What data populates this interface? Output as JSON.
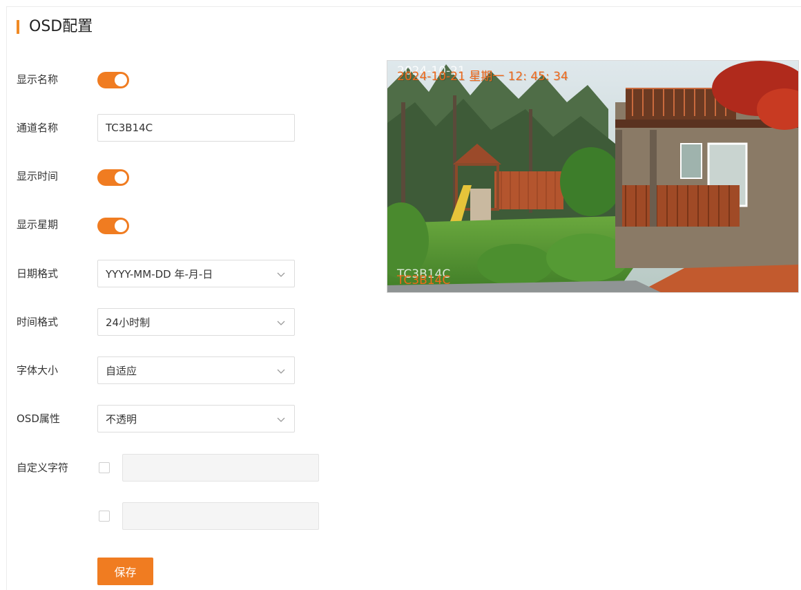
{
  "page": {
    "title": "OSD配置",
    "accent_color": "#f07c21"
  },
  "form": {
    "show_name": {
      "label": "显示名称",
      "on": true
    },
    "channel_name": {
      "label": "通道名称",
      "value": "TC3B14C"
    },
    "show_time": {
      "label": "显示时间",
      "on": true
    },
    "show_weekday": {
      "label": "显示星期",
      "on": true
    },
    "date_format": {
      "label": "日期格式",
      "value": "YYYY-MM-DD 年-月-日",
      "icon": "chevron-down-icon"
    },
    "time_format": {
      "label": "时间格式",
      "value": "24小时制",
      "icon": "chevron-down-icon"
    },
    "font_size": {
      "label": "字体大小",
      "value": "自适应",
      "icon": "chevron-down-icon"
    },
    "osd_attribute": {
      "label": "OSD属性",
      "value": "不透明",
      "icon": "chevron-down-icon"
    },
    "custom_chars": {
      "label": "自定义字符",
      "rows": [
        {
          "checked": false,
          "value": ""
        },
        {
          "checked": false,
          "value": ""
        }
      ]
    },
    "save_label": "保存"
  },
  "preview": {
    "osd_time_text": "2024-10-21 星期一 12: 45: 34",
    "osd_time_ghost": "2024-10-21",
    "osd_name_text": "TC3B14C",
    "osd_name_ghost": "TC3B14C",
    "osd_color": "#f06a1c"
  }
}
